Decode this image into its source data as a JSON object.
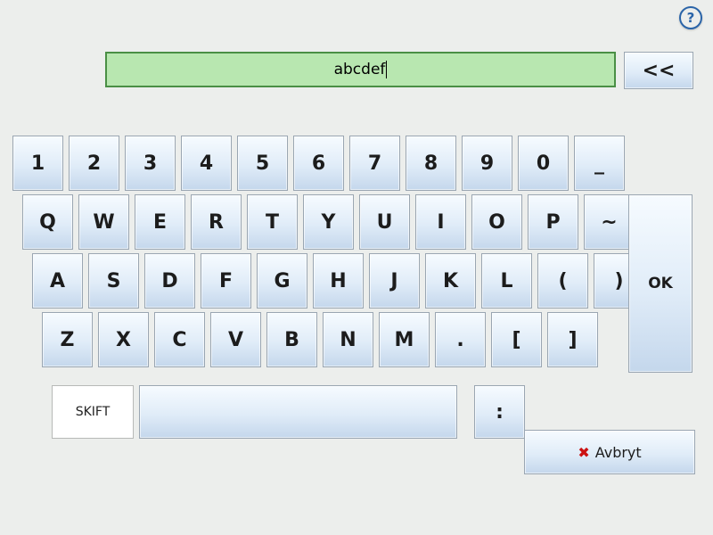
{
  "input": {
    "value": "abcdef"
  },
  "buttons": {
    "help": "?",
    "back": "<<",
    "ok": "OK",
    "cancel": "Avbryt",
    "shift": "SKIFT"
  },
  "rows": {
    "r1": [
      "1",
      "2",
      "3",
      "4",
      "5",
      "6",
      "7",
      "8",
      "9",
      "0",
      "_"
    ],
    "r2": [
      "Q",
      "W",
      "E",
      "R",
      "T",
      "Y",
      "U",
      "I",
      "O",
      "P",
      "~"
    ],
    "r3": [
      "A",
      "S",
      "D",
      "F",
      "G",
      "H",
      "J",
      "K",
      "L",
      "(",
      ")"
    ],
    "r4": [
      "Z",
      "X",
      "C",
      "V",
      "B",
      "N",
      "M",
      ".",
      "[",
      "]"
    ],
    "r5_symbol": ":"
  }
}
